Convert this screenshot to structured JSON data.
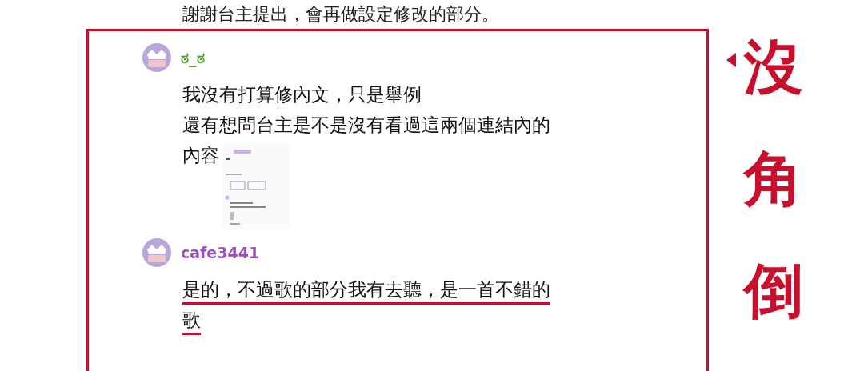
{
  "top_text": "謝謝台主提出，會再做設定修改的部分。",
  "comments": [
    {
      "username": "ಠ_ಠ",
      "color": "#4e9a2e",
      "lines": [
        "我沒有打算修內文，只是舉例",
        "還有想問台主是不是沒有看過這兩個連結內的",
        "內容"
      ],
      "underlined": false
    },
    {
      "username": "cafe3441",
      "color": "#9b4fb8",
      "lines": [
        "是的，不過歌的部分我有去聽，是一首不錯的",
        "歌"
      ],
      "underlined": true
    }
  ],
  "annotation": {
    "lines": [
      "沒",
      "角",
      "倒"
    ]
  }
}
